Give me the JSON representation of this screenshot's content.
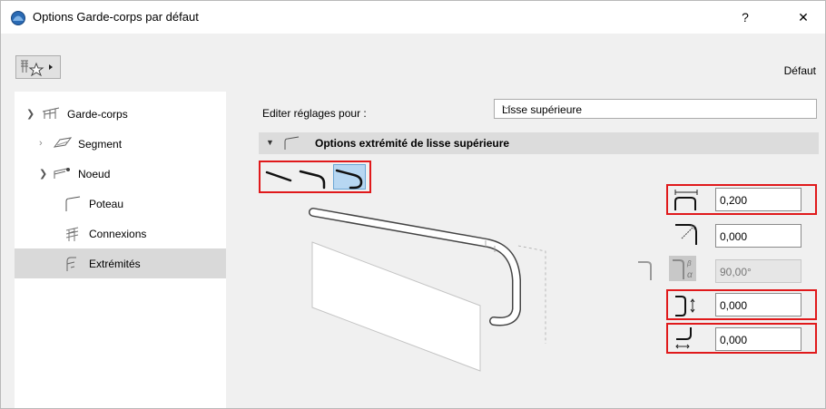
{
  "window": {
    "title": "Options Garde-corps par défaut",
    "help_label": "?",
    "close_label": "✕"
  },
  "toolbar": {
    "favorites_icon": "favorites-icon",
    "preset_label": "Défaut"
  },
  "tree": {
    "items": [
      {
        "label": "Garde-corps",
        "expanded": true,
        "level": 0
      },
      {
        "label": "Segment",
        "expanded": false,
        "level": 1
      },
      {
        "label": "Noeud",
        "expanded": true,
        "level": 1
      },
      {
        "label": "Poteau",
        "level": 2
      },
      {
        "label": "Connexions",
        "level": 2
      },
      {
        "label": "Extrémités",
        "level": 2,
        "selected": true
      }
    ]
  },
  "main": {
    "edit_label": "Editer réglages pour :",
    "edit_select_value": "Lisse supérieure",
    "section_title": "Options extrémité de lisse supérieure",
    "end_types": [
      "straight",
      "bent",
      "hook"
    ],
    "selected_end_type": "hook",
    "fields": [
      {
        "name": "extension-length",
        "value": "0,200",
        "enabled": true
      },
      {
        "name": "radius",
        "value": "0,000",
        "enabled": true
      },
      {
        "name": "angle",
        "value": "90,00°",
        "enabled": false
      },
      {
        "name": "vertical-offset",
        "value": "0,000",
        "enabled": true
      },
      {
        "name": "return-length",
        "value": "0,000",
        "enabled": true
      }
    ]
  },
  "colors": {
    "highlight_red": "#e0191b",
    "selected_blue": "#b7d7f2",
    "tree_selection": "#d9d9d9"
  }
}
